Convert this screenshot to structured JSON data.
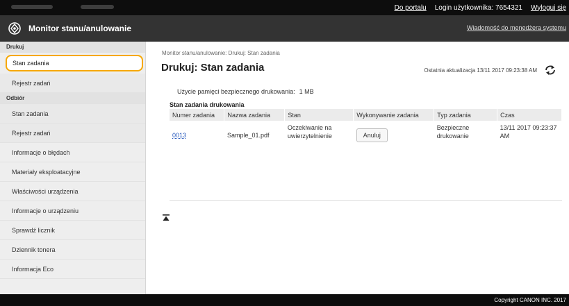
{
  "topbar": {
    "portal_link": "Do portalu",
    "login_label": "Login użytkownika:",
    "login_id": "7654321",
    "logout_link": "Wyloguj się"
  },
  "titlebar": {
    "logo_icon": "canon-remote-ui-logo",
    "app_title": "Monitor stanu/anulowanie",
    "message_link": "Wiadomość do menedżera systemu"
  },
  "sidebar": {
    "print_section": "Drukuj",
    "print_items": [
      {
        "label": "Stan zadania",
        "active": true
      },
      {
        "label": "Rejestr zadań"
      }
    ],
    "receive_section": "Odbiór",
    "receive_items": [
      {
        "label": "Stan zadania"
      },
      {
        "label": "Rejestr zadań"
      }
    ],
    "other_items": [
      {
        "label": "Informacje o błędach"
      },
      {
        "label": "Materiały eksploatacyjne"
      },
      {
        "label": "Właściwości urządzenia"
      },
      {
        "label": "Informacje o urządzeniu"
      },
      {
        "label": "Sprawdź licznik"
      },
      {
        "label": "Dziennik tonera"
      },
      {
        "label": "Informacja Eco"
      }
    ]
  },
  "main": {
    "breadcrumb": "Monitor stanu/anulowanie: Drukuj: Stan zadania",
    "page_title": "Drukuj: Stan zadania",
    "last_updated": "Ostatnia aktualizacja 13/11 2017 09:23:38 AM",
    "refresh_icon": "refresh-arrows-icon",
    "memory_label": "Użycie pamięci bezpiecznego drukowania:",
    "memory_value": "1 MB",
    "status_heading": "Stan zadania drukowania",
    "columns": [
      "Numer zadania",
      "Nazwa zadania",
      "Stan",
      "Wykonywanie zadania",
      "Typ zadania",
      "Czas"
    ],
    "job": {
      "number": "0013",
      "name": "Sample_01.pdf",
      "status": "Oczekiwanie na uwierzytelnienie",
      "action": "Anuluj",
      "type": "Bezpieczne drukowanie",
      "time": "13/11 2017 09:23:37 AM"
    },
    "top_icon": "jump-to-top-icon"
  },
  "footer": {
    "copyright": "Copyright CANON INC. 2017"
  },
  "colors": {
    "active_outline": "#f6a800",
    "header_bg": "#333333",
    "link": "#2255bb"
  }
}
